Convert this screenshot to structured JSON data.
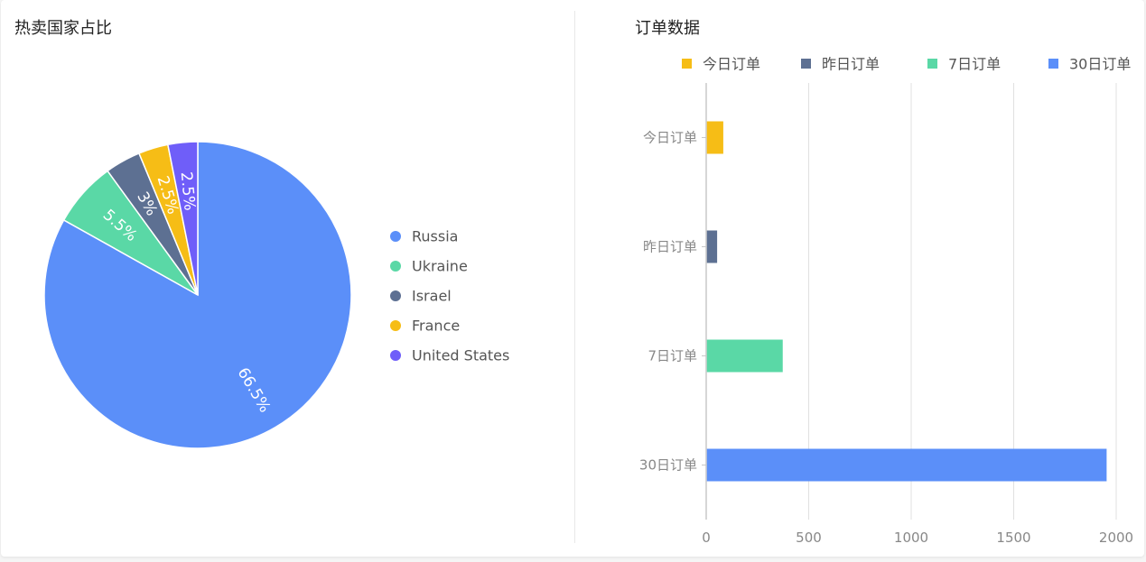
{
  "left_panel": {
    "title": "热卖国家占比"
  },
  "right_panel": {
    "title": "订单数据"
  },
  "chart_data": [
    {
      "type": "pie",
      "title": "热卖国家占比",
      "legend_position": "right",
      "slices": [
        {
          "name": "Russia",
          "value": 66.5,
          "label": "66.5%",
          "color": "#5b8ff9"
        },
        {
          "name": "Ukraine",
          "value": 5.5,
          "label": "5.5%",
          "color": "#5ad8a6"
        },
        {
          "name": "Israel",
          "value": 3,
          "label": "3%",
          "color": "#5d7092"
        },
        {
          "name": "France",
          "value": 2.5,
          "label": "2.5%",
          "color": "#f6bd16"
        },
        {
          "name": "United States",
          "value": 2.5,
          "label": "2.5%",
          "color": "#6f5ef9"
        }
      ]
    },
    {
      "type": "bar",
      "orientation": "horizontal",
      "title": "订单数据",
      "legend_position": "top",
      "categories": [
        "今日订单",
        "昨日订单",
        "7日订单",
        "30日订单"
      ],
      "series": [
        {
          "name": "今日订单",
          "category": "今日订单",
          "value": 80,
          "color": "#f6bd16"
        },
        {
          "name": "昨日订单",
          "category": "昨日订单",
          "value": 50,
          "color": "#5d7092"
        },
        {
          "name": "7日订单",
          "category": "7日订单",
          "value": 370,
          "color": "#5ad8a6"
        },
        {
          "name": "30日订单",
          "category": "30日订单",
          "value": 1950,
          "color": "#5b8ff9"
        }
      ],
      "x_ticks": [
        0,
        500,
        1000,
        1500,
        2000
      ],
      "xlim": [
        0,
        2000
      ],
      "grid": true
    }
  ]
}
